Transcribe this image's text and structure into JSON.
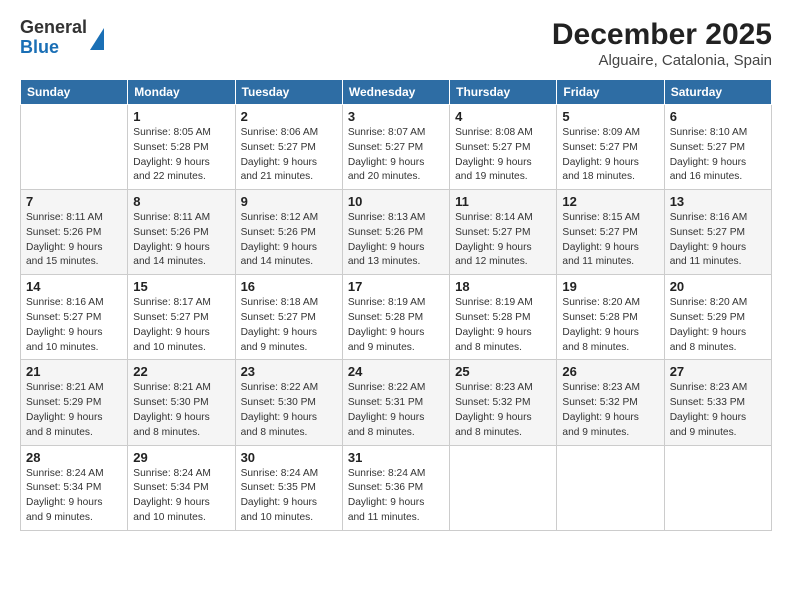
{
  "logo": {
    "general": "General",
    "blue": "Blue"
  },
  "title": "December 2025",
  "subtitle": "Alguaire, Catalonia, Spain",
  "days_header": [
    "Sunday",
    "Monday",
    "Tuesday",
    "Wednesday",
    "Thursday",
    "Friday",
    "Saturday"
  ],
  "weeks": [
    [
      {
        "day": "",
        "info": ""
      },
      {
        "day": "1",
        "info": "Sunrise: 8:05 AM\nSunset: 5:28 PM\nDaylight: 9 hours\nand 22 minutes."
      },
      {
        "day": "2",
        "info": "Sunrise: 8:06 AM\nSunset: 5:27 PM\nDaylight: 9 hours\nand 21 minutes."
      },
      {
        "day": "3",
        "info": "Sunrise: 8:07 AM\nSunset: 5:27 PM\nDaylight: 9 hours\nand 20 minutes."
      },
      {
        "day": "4",
        "info": "Sunrise: 8:08 AM\nSunset: 5:27 PM\nDaylight: 9 hours\nand 19 minutes."
      },
      {
        "day": "5",
        "info": "Sunrise: 8:09 AM\nSunset: 5:27 PM\nDaylight: 9 hours\nand 18 minutes."
      },
      {
        "day": "6",
        "info": "Sunrise: 8:10 AM\nSunset: 5:27 PM\nDaylight: 9 hours\nand 16 minutes."
      }
    ],
    [
      {
        "day": "7",
        "info": "Sunrise: 8:11 AM\nSunset: 5:26 PM\nDaylight: 9 hours\nand 15 minutes."
      },
      {
        "day": "8",
        "info": "Sunrise: 8:11 AM\nSunset: 5:26 PM\nDaylight: 9 hours\nand 14 minutes."
      },
      {
        "day": "9",
        "info": "Sunrise: 8:12 AM\nSunset: 5:26 PM\nDaylight: 9 hours\nand 14 minutes."
      },
      {
        "day": "10",
        "info": "Sunrise: 8:13 AM\nSunset: 5:26 PM\nDaylight: 9 hours\nand 13 minutes."
      },
      {
        "day": "11",
        "info": "Sunrise: 8:14 AM\nSunset: 5:27 PM\nDaylight: 9 hours\nand 12 minutes."
      },
      {
        "day": "12",
        "info": "Sunrise: 8:15 AM\nSunset: 5:27 PM\nDaylight: 9 hours\nand 11 minutes."
      },
      {
        "day": "13",
        "info": "Sunrise: 8:16 AM\nSunset: 5:27 PM\nDaylight: 9 hours\nand 11 minutes."
      }
    ],
    [
      {
        "day": "14",
        "info": "Sunrise: 8:16 AM\nSunset: 5:27 PM\nDaylight: 9 hours\nand 10 minutes."
      },
      {
        "day": "15",
        "info": "Sunrise: 8:17 AM\nSunset: 5:27 PM\nDaylight: 9 hours\nand 10 minutes."
      },
      {
        "day": "16",
        "info": "Sunrise: 8:18 AM\nSunset: 5:27 PM\nDaylight: 9 hours\nand 9 minutes."
      },
      {
        "day": "17",
        "info": "Sunrise: 8:19 AM\nSunset: 5:28 PM\nDaylight: 9 hours\nand 9 minutes."
      },
      {
        "day": "18",
        "info": "Sunrise: 8:19 AM\nSunset: 5:28 PM\nDaylight: 9 hours\nand 8 minutes."
      },
      {
        "day": "19",
        "info": "Sunrise: 8:20 AM\nSunset: 5:28 PM\nDaylight: 9 hours\nand 8 minutes."
      },
      {
        "day": "20",
        "info": "Sunrise: 8:20 AM\nSunset: 5:29 PM\nDaylight: 9 hours\nand 8 minutes."
      }
    ],
    [
      {
        "day": "21",
        "info": "Sunrise: 8:21 AM\nSunset: 5:29 PM\nDaylight: 9 hours\nand 8 minutes."
      },
      {
        "day": "22",
        "info": "Sunrise: 8:21 AM\nSunset: 5:30 PM\nDaylight: 9 hours\nand 8 minutes."
      },
      {
        "day": "23",
        "info": "Sunrise: 8:22 AM\nSunset: 5:30 PM\nDaylight: 9 hours\nand 8 minutes."
      },
      {
        "day": "24",
        "info": "Sunrise: 8:22 AM\nSunset: 5:31 PM\nDaylight: 9 hours\nand 8 minutes."
      },
      {
        "day": "25",
        "info": "Sunrise: 8:23 AM\nSunset: 5:32 PM\nDaylight: 9 hours\nand 8 minutes."
      },
      {
        "day": "26",
        "info": "Sunrise: 8:23 AM\nSunset: 5:32 PM\nDaylight: 9 hours\nand 9 minutes."
      },
      {
        "day": "27",
        "info": "Sunrise: 8:23 AM\nSunset: 5:33 PM\nDaylight: 9 hours\nand 9 minutes."
      }
    ],
    [
      {
        "day": "28",
        "info": "Sunrise: 8:24 AM\nSunset: 5:34 PM\nDaylight: 9 hours\nand 9 minutes."
      },
      {
        "day": "29",
        "info": "Sunrise: 8:24 AM\nSunset: 5:34 PM\nDaylight: 9 hours\nand 10 minutes."
      },
      {
        "day": "30",
        "info": "Sunrise: 8:24 AM\nSunset: 5:35 PM\nDaylight: 9 hours\nand 10 minutes."
      },
      {
        "day": "31",
        "info": "Sunrise: 8:24 AM\nSunset: 5:36 PM\nDaylight: 9 hours\nand 11 minutes."
      },
      {
        "day": "",
        "info": ""
      },
      {
        "day": "",
        "info": ""
      },
      {
        "day": "",
        "info": ""
      }
    ]
  ]
}
